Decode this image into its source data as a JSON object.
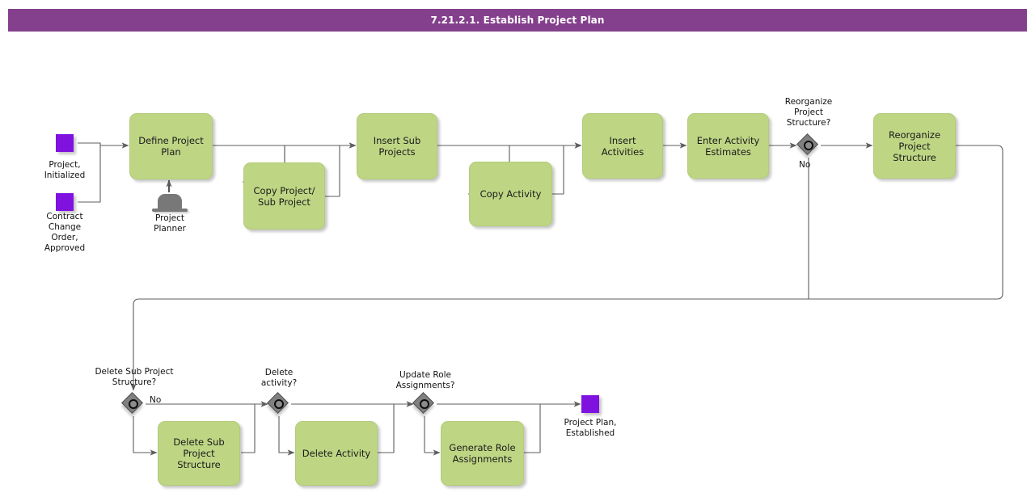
{
  "header": {
    "title": "7.21.2.1. Establish Project Plan",
    "bar_color": "#84408c"
  },
  "palette": {
    "task_fill": "#bed684",
    "event_fill": "#8012e0",
    "gateway_fill": "#808080",
    "connector": "#595959",
    "text": "#111111"
  },
  "events": [
    {
      "id": "start-project-initialized",
      "label": "Project,\nInitialized",
      "type": "start"
    },
    {
      "id": "start-contract-change-order",
      "label": "Contract\nChange\nOrder,\nApproved",
      "type": "start"
    },
    {
      "id": "end-project-plan-established",
      "label": "Project Plan,\nEstablished",
      "type": "end"
    }
  ],
  "tasks": [
    {
      "id": "define-project-plan",
      "label": "Define Project\nPlan"
    },
    {
      "id": "copy-project-sub-project",
      "label": "Copy Project/\nSub Project"
    },
    {
      "id": "insert-sub-projects",
      "label": "Insert Sub\nProjects"
    },
    {
      "id": "copy-activity",
      "label": "Copy Activity"
    },
    {
      "id": "insert-activities",
      "label": "Insert Activities"
    },
    {
      "id": "enter-activity-estimates",
      "label": "Enter Activity\nEstimates"
    },
    {
      "id": "reorganize-project-structure",
      "label": "Reorganize\nProject\nStructure"
    },
    {
      "id": "delete-sub-project-structure",
      "label": "Delete Sub\nProject\nStructure"
    },
    {
      "id": "delete-activity",
      "label": "Delete Activity"
    },
    {
      "id": "generate-role-assignments",
      "label": "Generate Role\nAssignments"
    }
  ],
  "gateways": [
    {
      "id": "gw-reorganize-project-structure",
      "label": "Reorganize\nProject\nStructure?",
      "branch_label": "No"
    },
    {
      "id": "gw-delete-sub-project-structure",
      "label": "Delete Sub Project\nStructure?",
      "branch_label": "No"
    },
    {
      "id": "gw-delete-activity",
      "label": "Delete\nactivity?",
      "branch_label": ""
    },
    {
      "id": "gw-update-role-assignments",
      "label": "Update Role\nAssignments?",
      "branch_label": ""
    }
  ],
  "roles": [
    {
      "id": "role-project-planner",
      "label": "Project\nPlanner"
    }
  ]
}
